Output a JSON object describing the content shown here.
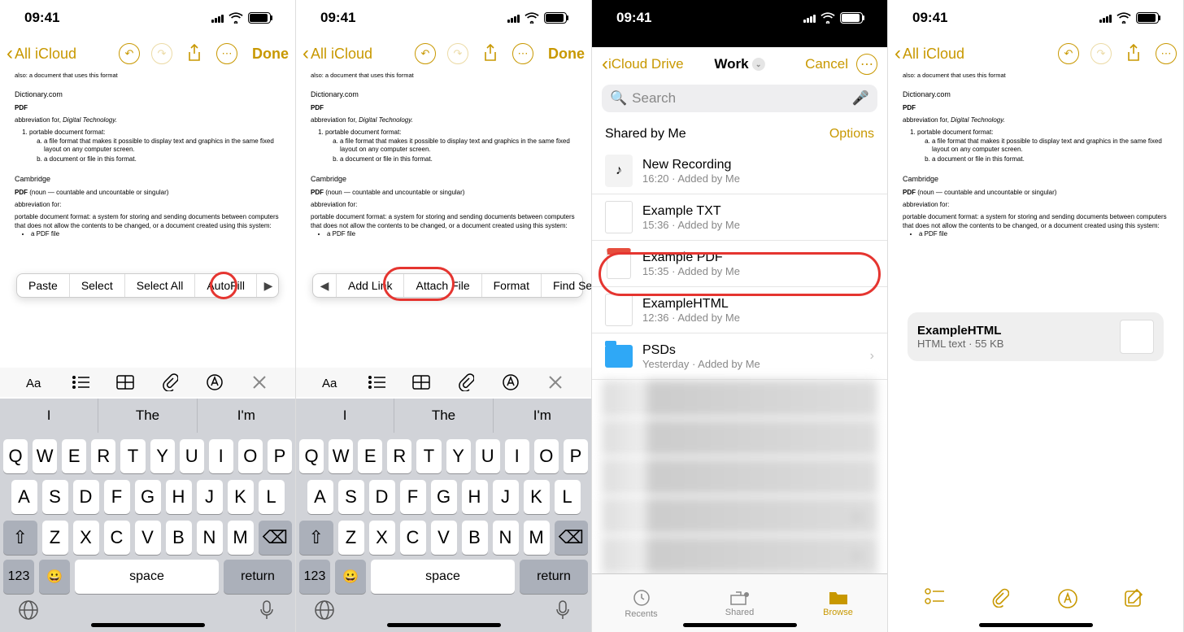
{
  "status": {
    "time": "09:41"
  },
  "nav": {
    "back_label": "All iCloud",
    "done": "Done"
  },
  "note": {
    "line_top": "also: a document that uses this format",
    "source_dict": "Dictionary.com",
    "pdf": "PDF",
    "abbr_for": "abbreviation for, ",
    "abbr_it": "Digital Technology.",
    "li1": "portable document format:",
    "li1a": "a file format that makes it possible to display text and graphics in the same fixed layout on any computer screen.",
    "li1b": "a document or file in this format.",
    "source_cam": "Cambridge",
    "pdf_paren": " (noun — countable and uncountable or singular)",
    "abbr_for2": "abbreviation for:",
    "para": "portable document format: a system for storing and sending documents between computers that does not allow the contents to be changed, or a document created using this system:",
    "bullet": "a PDF file"
  },
  "context1": [
    "Paste",
    "Select",
    "Select All",
    "AutoFill"
  ],
  "context2": [
    "Add Link",
    "Attach File",
    "Format",
    "Find Selection"
  ],
  "suggestions": [
    "I",
    "The",
    "I'm"
  ],
  "kb": {
    "row1": [
      "Q",
      "W",
      "E",
      "R",
      "T",
      "Y",
      "U",
      "I",
      "O",
      "P"
    ],
    "row2": [
      "A",
      "S",
      "D",
      "F",
      "G",
      "H",
      "J",
      "K",
      "L"
    ],
    "row3": [
      "Z",
      "X",
      "C",
      "V",
      "B",
      "N",
      "M"
    ],
    "num": "123",
    "space": "space",
    "return": "return"
  },
  "files": {
    "back": "iCloud Drive",
    "title": "Work",
    "cancel": "Cancel",
    "search_ph": "Search",
    "section": "Shared by Me",
    "options": "Options",
    "rows": [
      {
        "name": "New Recording",
        "sub": "16:20 · Added by Me"
      },
      {
        "name": "Example TXT",
        "sub": "15:36 · Added by Me"
      },
      {
        "name": "Example PDF",
        "sub": "15:35 · Added by Me"
      },
      {
        "name": "ExampleHTML",
        "sub": "12:36 · Added by Me"
      },
      {
        "name": "PSDs",
        "sub": "Yesterday · Added by Me"
      }
    ],
    "tabs": {
      "recents": "Recents",
      "shared": "Shared",
      "browse": "Browse"
    }
  },
  "attachment": {
    "name": "ExampleHTML",
    "sub": "HTML text · 55 KB"
  }
}
